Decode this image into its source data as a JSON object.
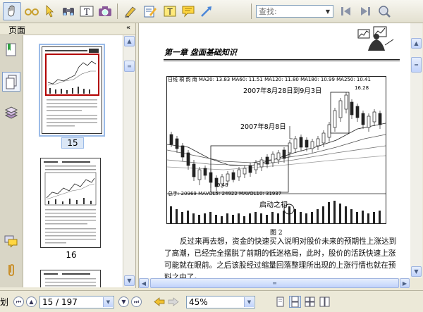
{
  "toolbar": {
    "find_placeholder": "查找:",
    "buttons": [
      "hand-tool",
      "select-text-tool",
      "select-arrow-tool",
      "binoculars",
      "text-select",
      "snapshot",
      "highlight-pen",
      "notes",
      "text-box",
      "comment",
      "arrow-annot"
    ]
  },
  "left_pane": {
    "title": "页面",
    "collapse": "«",
    "thumbnails": [
      {
        "page": "15",
        "selected": true
      },
      {
        "page": "16",
        "selected": false
      }
    ]
  },
  "document": {
    "header": "第一章 盘面基础知识",
    "chart": {
      "info_line": "日线  桐 韵 南 MA20: 13.83 MA60: 11.51 MA120: 11.80 MA180: 10.99 MA250: 10.41",
      "annot_1": "2007年8月28日到9月3日",
      "annot_2": "2007年8月8日",
      "price_high": "16.28",
      "price_low": "9.48",
      "vol_line": "总手: 20969 MAVOL5: 24922 MAVOL10: 31937",
      "vol_annot": "启动之初"
    },
    "figure_caption": "图 2",
    "body_text": "反过来再去想，资金的快速买入说明对股价未来的预期性上涨达到了高潮，已经完全摆脱了前期的低迷格局，此时，股价的活跃快速上涨可能就在眼前。之后该股经过缩量回落整理所出现的上涨行情也就在预料之中了。"
  },
  "status": {
    "prefix": "划",
    "page_field": "15 / 197",
    "zoom_field": "45%"
  },
  "colors": {
    "accent": "#7e9bc6",
    "selection_frame": "#9bbbe8"
  }
}
